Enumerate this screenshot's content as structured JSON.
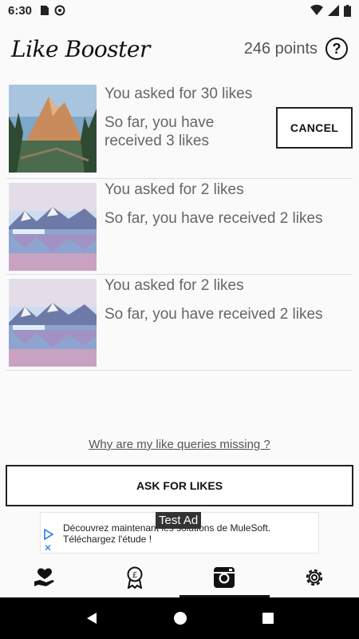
{
  "status": {
    "time": "6:30"
  },
  "header": {
    "logo": "Like Booster",
    "points": "246 points",
    "help_symbol": "?"
  },
  "requests": [
    {
      "asked": "You asked for 30 likes",
      "received": "So far, you have received 3 likes",
      "action": "CANCEL",
      "image": "mountain-lake"
    },
    {
      "asked": "You asked for 2 likes",
      "received": "So far, you have received 2 likes",
      "image": "glacier-lake"
    },
    {
      "asked": "You asked for 2 likes",
      "received": "So far, you have received 2 likes",
      "image": "glacier-lake"
    }
  ],
  "why_link": "Why are my like queries missing ?",
  "ask_button": "ASK FOR LIKES",
  "ad": {
    "badge": "Test Ad",
    "line1": "Découvrez maintenant les solutions de MuleSoft.",
    "line2": "Téléchargez l'étude !"
  },
  "tabs": [
    "heart-hand-icon",
    "badge-icon",
    "instagram-icon",
    "gear-icon"
  ],
  "active_tab": 2
}
